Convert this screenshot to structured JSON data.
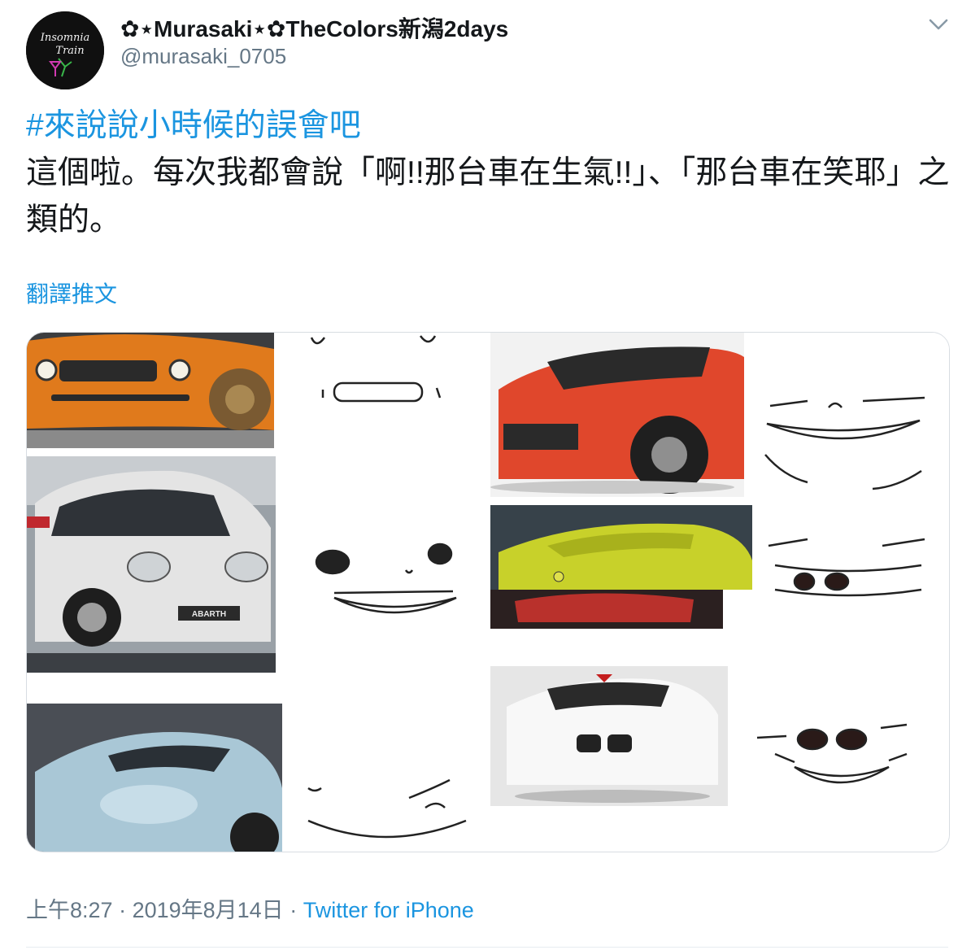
{
  "author": {
    "display_name": "✿⋆Murasaki⋆✿TheColors新潟2days",
    "handle": "@murasaki_0705",
    "avatar_text": "Insomnia Train"
  },
  "tweet": {
    "hashtag": "#來說說小時候的誤會吧",
    "body": "這個啦。每次我都會說「啊!!那台車在生氣!!」、「那台車在笑耶」之類的。",
    "translate_label": "翻譯推文"
  },
  "media": {
    "car_badges": [
      "ABARTH"
    ]
  },
  "meta": {
    "time": "上午8:27",
    "separator": " · ",
    "date": "2019年8月14日",
    "separator2": " · ",
    "source": "Twitter for iPhone"
  },
  "colors": {
    "link": "#1b95e0",
    "secondary_text": "#657786",
    "border": "#d8dde2"
  },
  "icons": {
    "more": "chevron-down-icon"
  }
}
